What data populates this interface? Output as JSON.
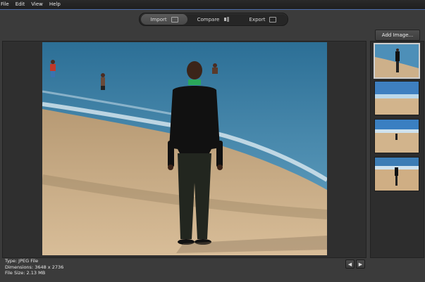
{
  "menu": [
    "File",
    "Edit",
    "View",
    "Help"
  ],
  "modes": [
    {
      "label": "Import",
      "icon": "import-icon"
    },
    {
      "label": "Compare",
      "icon": "compare-icon"
    },
    {
      "label": "Export",
      "icon": "export-icon"
    }
  ],
  "add_image_label": "Add Image...",
  "info": {
    "type": "Type: JPEG File",
    "dimensions": "Dimensions: 3648 x 2736",
    "filesize": "File Size: 2.13 MB"
  },
  "nav": {
    "prev": "◀",
    "next": "▶"
  },
  "thumbnails": [
    {
      "name": "thumb-man-on-beach",
      "selected": true
    },
    {
      "name": "thumb-beach-empty",
      "selected": false
    },
    {
      "name": "thumb-beach-figure",
      "selected": false
    },
    {
      "name": "thumb-beach-man-standing",
      "selected": false
    }
  ],
  "colors": {
    "accent": "#4f6fae",
    "background": "#3b3b3b"
  }
}
